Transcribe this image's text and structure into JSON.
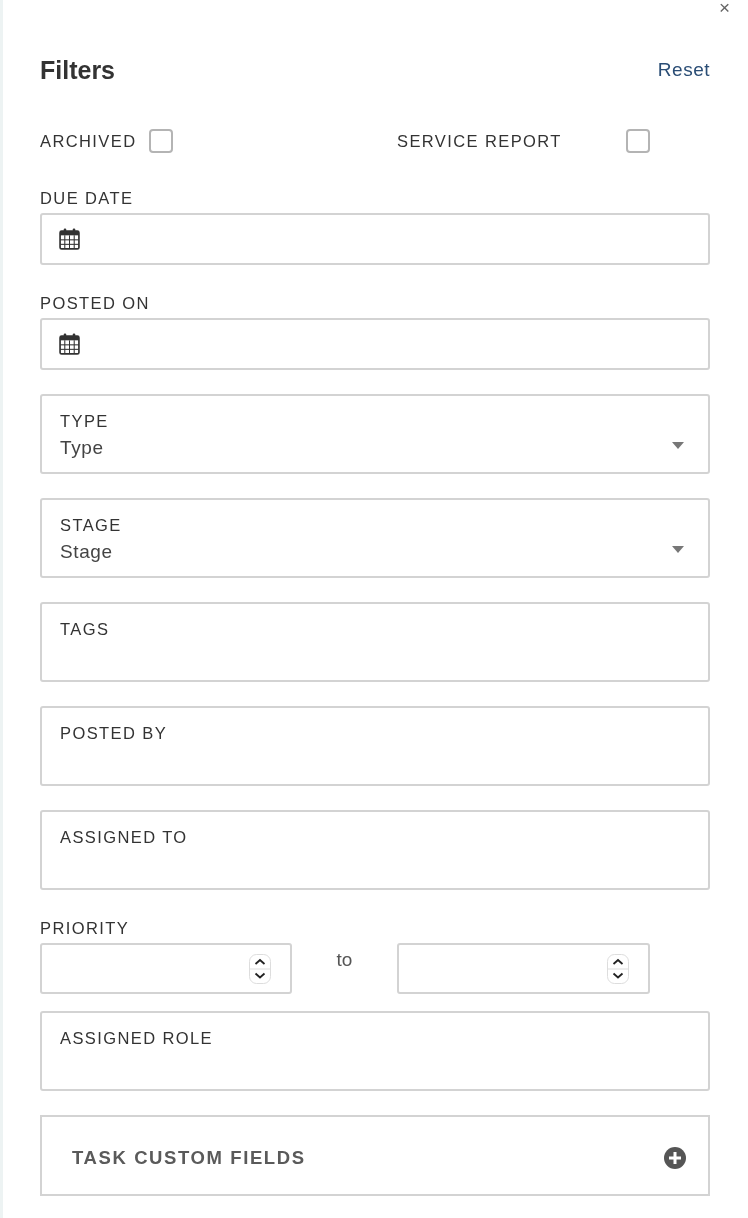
{
  "panel": {
    "close": "×",
    "title": "Filters",
    "reset": "Reset"
  },
  "checkboxes": [
    {
      "label": "ARCHIVED",
      "checked": false
    },
    {
      "label": "SERVICE REPORT",
      "checked": false
    }
  ],
  "date_fields": [
    {
      "label": "DUE DATE"
    },
    {
      "label": "POSTED ON"
    }
  ],
  "fields": [
    {
      "kind": "select",
      "label": "TYPE",
      "placeholder": "Type"
    },
    {
      "kind": "select",
      "label": "STAGE",
      "placeholder": "Stage"
    },
    {
      "kind": "text",
      "label": "TAGS"
    },
    {
      "kind": "text",
      "label": "POSTED BY"
    },
    {
      "kind": "text",
      "label": "ASSIGNED TO"
    }
  ],
  "priority": {
    "label": "PRIORITY",
    "separator": "to"
  },
  "more_fields": [
    {
      "kind": "text",
      "label": "ASSIGNED ROLE"
    }
  ],
  "section": {
    "label": "TASK CUSTOM FIELDS",
    "expanded": false
  }
}
